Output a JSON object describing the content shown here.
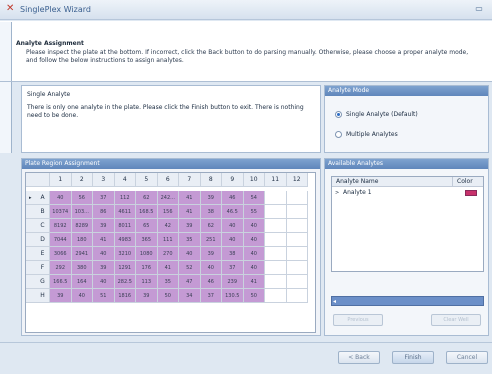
{
  "window": {
    "title": "SinglePlex Wizard",
    "minimize_glyph": "▭"
  },
  "header": {
    "title": "Analyte Assignment",
    "description": "Please inspect the plate at the bottom. If incorrect, click the Back button to do parsing manually. Otherwise, please choose a proper analyte mode, and follow the below instructions to assign analytes."
  },
  "info": {
    "title": "Single Analyte",
    "text": "There is only one analyte in the plate. Please click the Finish button to exit. There is nothing need to be done."
  },
  "analyte_mode": {
    "header": "Analyte Mode",
    "options": [
      {
        "label": "Single Analyte (Default)",
        "checked": true
      },
      {
        "label": "Multiple Analytes",
        "checked": false
      }
    ]
  },
  "plate": {
    "header": "Plate Region Assignment",
    "columns": [
      "1",
      "2",
      "3",
      "4",
      "5",
      "6",
      "7",
      "8",
      "9",
      "10",
      "11",
      "12"
    ],
    "rows": [
      {
        "label": "A",
        "cells": [
          "40",
          "56",
          "37",
          "112",
          "62",
          "242...",
          "41",
          "39",
          "46",
          "54",
          "",
          ""
        ]
      },
      {
        "label": "B",
        "cells": [
          "10374",
          "103...",
          "86",
          "4611",
          "168.5",
          "156",
          "41",
          "38",
          "46.5",
          "55",
          "",
          ""
        ]
      },
      {
        "label": "C",
        "cells": [
          "8192",
          "8289",
          "39",
          "8011",
          "65",
          "42",
          "39",
          "62",
          "40",
          "40",
          "",
          ""
        ]
      },
      {
        "label": "D",
        "cells": [
          "7044",
          "180",
          "41",
          "4983",
          "365",
          "111",
          "35",
          "251",
          "40",
          "40",
          "",
          ""
        ]
      },
      {
        "label": "E",
        "cells": [
          "3066",
          "2941",
          "40",
          "3210",
          "1080",
          "270",
          "40",
          "39",
          "38",
          "40",
          "",
          ""
        ]
      },
      {
        "label": "F",
        "cells": [
          "292",
          "380",
          "39",
          "1291",
          "176",
          "41",
          "52",
          "40",
          "37",
          "40",
          "",
          ""
        ]
      },
      {
        "label": "G",
        "cells": [
          "166.5",
          "164",
          "40",
          "282.5",
          "113",
          "35",
          "47",
          "46",
          "239",
          "41",
          "",
          ""
        ]
      },
      {
        "label": "H",
        "cells": [
          "39",
          "40",
          "51",
          "1816",
          "39",
          "50",
          "34",
          "37",
          "130.5",
          "50",
          "",
          ""
        ]
      }
    ],
    "selected_row": "A"
  },
  "available_analytes": {
    "header": "Available Analytes",
    "columns": [
      "Analyte Name",
      "Color"
    ],
    "rows": [
      {
        "name": "Analyte 1",
        "color": "#c8316b"
      }
    ],
    "buttons": [
      "Previous",
      "Clear Well"
    ]
  },
  "nav": {
    "back": "< Back",
    "finish": "Finish",
    "cancel": "Cancel"
  },
  "icons": {
    "title_icon": "wizard-icon",
    "row_pointer": "row-pointer-icon",
    "scroll_arrow": "scroll-left-icon"
  }
}
